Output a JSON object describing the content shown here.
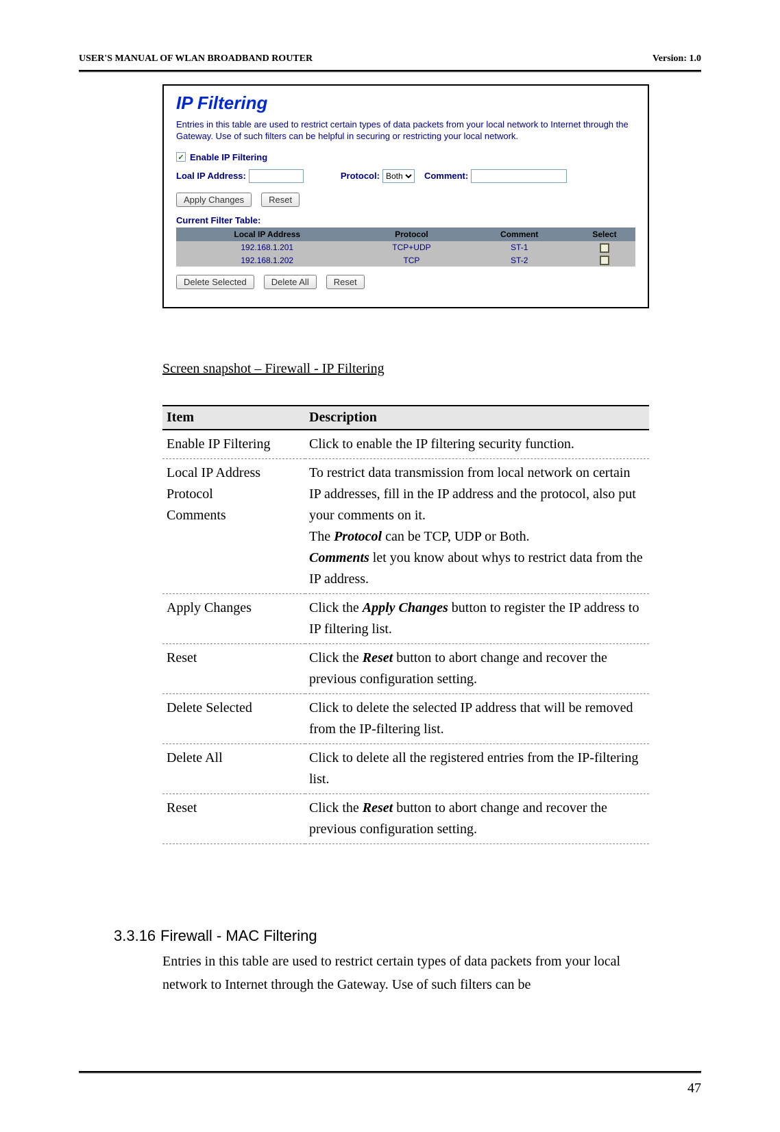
{
  "header": {
    "left": "USER'S MANUAL OF WLAN BROADBAND ROUTER",
    "right": "Version: 1.0"
  },
  "pageNumber": "47",
  "screenshot": {
    "title": "IP Filtering",
    "intro": "Entries in this table are used to restrict certain types of data packets from your local network to Internet through the Gateway. Use of such filters can be helpful in securing or restricting your local network.",
    "enableLabel": "Enable IP Filtering",
    "localIpLabel": "Loal IP Address:",
    "protocolLabel": "Protocol:",
    "protocolValue": "Both",
    "commentLabel": "Comment:",
    "btnApply": "Apply Changes",
    "btnReset": "Reset",
    "tableTitle": "Current Filter Table:",
    "headers": {
      "ip": "Local IP Address",
      "protocol": "Protocol",
      "comment": "Comment",
      "select": "Select"
    },
    "rows": [
      {
        "ip": "192.168.1.201",
        "protocol": "TCP+UDP",
        "comment": "ST-1"
      },
      {
        "ip": "192.168.1.202",
        "protocol": "TCP",
        "comment": "ST-2"
      }
    ],
    "btnDeleteSelected": "Delete Selected",
    "btnDeleteAll": "Delete All",
    "btnReset2": "Reset"
  },
  "caption": "Screen snapshot – Firewall - IP Filtering",
  "descTable": {
    "colItem": "Item",
    "colDesc": "Description",
    "rows": {
      "r1_item": "Enable IP Filtering",
      "r1_desc": "Click to enable the IP filtering security function.",
      "r2_item_l1": "Local IP Address",
      "r2_item_l2": "Protocol",
      "r2_item_l3": "Comments",
      "r2_desc_p1": "To restrict data transmission from local network on certain IP addresses, fill in the IP address and the protocol, also put your comments on it.",
      "r2_desc_p2a": "The ",
      "r2_desc_p2b": "Protocol",
      "r2_desc_p2c": " can be TCP, UDP or Both.",
      "r2_desc_p3a": "Comments",
      "r2_desc_p3b": " let you know about whys to restrict data from the IP address.",
      "r3_item": "Apply Changes",
      "r3_desc_a": "Click the ",
      "r3_desc_b": "Apply Changes",
      "r3_desc_c": " button to register the IP address to IP filtering list.",
      "r4_item": "Reset",
      "r4_desc_a": "Click the ",
      "r4_desc_b": "Reset",
      "r4_desc_c": " button to abort change and recover the previous configuration setting.",
      "r5_item": "Delete Selected",
      "r5_desc": "Click to delete the selected IP address that will be removed from the IP-filtering list.",
      "r6_item": "Delete All",
      "r6_desc": "Click to delete all the registered entries from the IP-filtering list.",
      "r7_item": "Reset",
      "r7_desc_a": "Click the ",
      "r7_desc_b": "Reset",
      "r7_desc_c": " button to abort change and recover the previous configuration setting."
    }
  },
  "section": {
    "number": "3.3.16",
    "title": "Firewall - MAC Filtering",
    "text": "Entries in this table are used to restrict certain types of data packets from your local network to Internet through the Gateway. Use of such filters can be"
  }
}
